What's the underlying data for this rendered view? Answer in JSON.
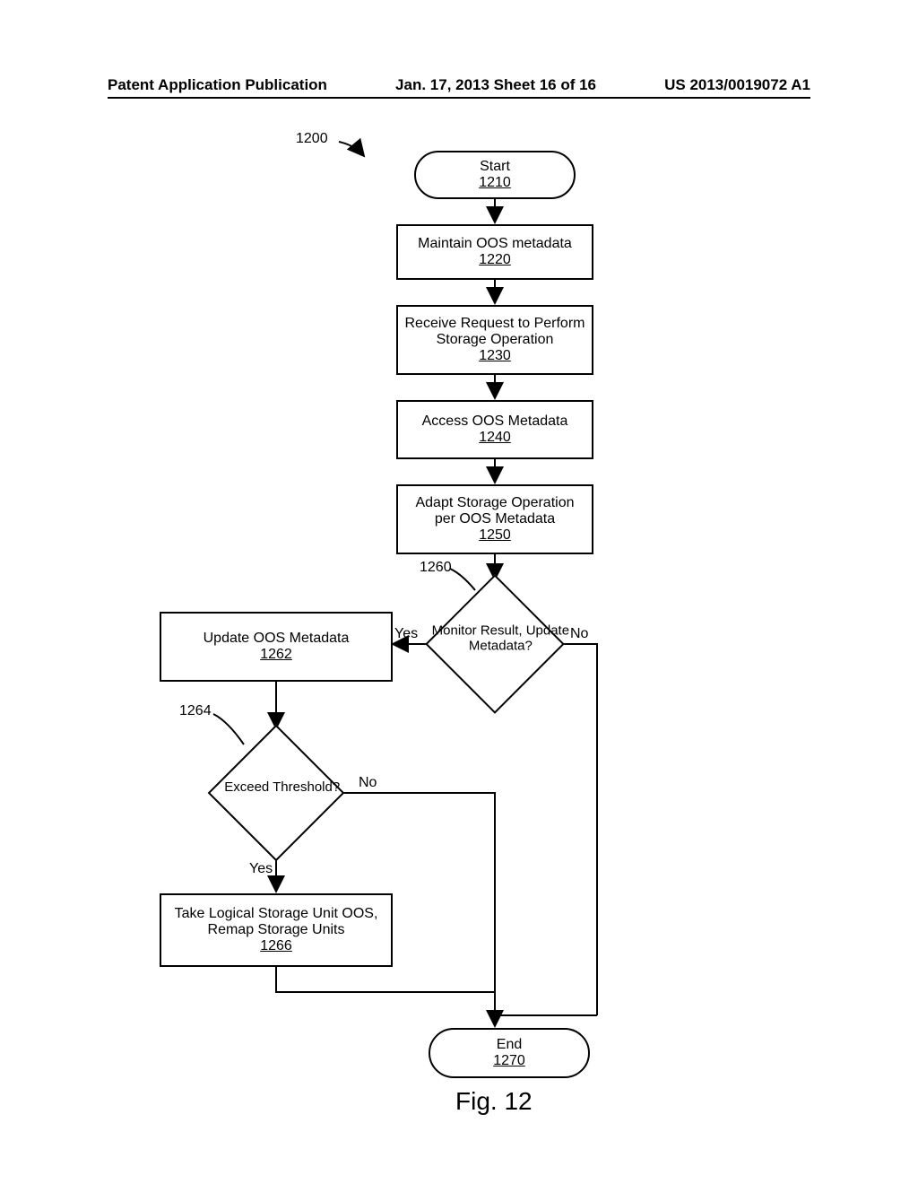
{
  "header": {
    "left": "Patent Application Publication",
    "center": "Jan. 17, 2013  Sheet 16 of 16",
    "right": "US 2013/0019072 A1"
  },
  "figure_ref": "1200",
  "nodes": {
    "start": {
      "label": "Start",
      "num": "1210"
    },
    "maintain": {
      "label": "Maintain OOS metadata",
      "num": "1220"
    },
    "receive": {
      "label": "Receive Request to Perform Storage Operation",
      "num": "1230"
    },
    "access": {
      "label": "Access OOS Metadata",
      "num": "1240"
    },
    "adapt": {
      "label": "Adapt Storage Operation per OOS Metadata",
      "num": "1250"
    },
    "monitor": {
      "label": "Monitor Result, Update Metadata?",
      "num": "1260"
    },
    "update": {
      "label": "Update OOS Metadata",
      "num": "1262"
    },
    "threshold": {
      "label": "Exceed Threshold?",
      "num": "1264"
    },
    "take": {
      "label": "Take Logical Storage Unit OOS, Remap Storage Units",
      "num": "1266"
    },
    "end": {
      "label": "End",
      "num": "1270"
    }
  },
  "edge_labels": {
    "yes1": "Yes",
    "no1": "No",
    "yes2": "Yes",
    "no2": "No"
  },
  "caption": "Fig. 12"
}
